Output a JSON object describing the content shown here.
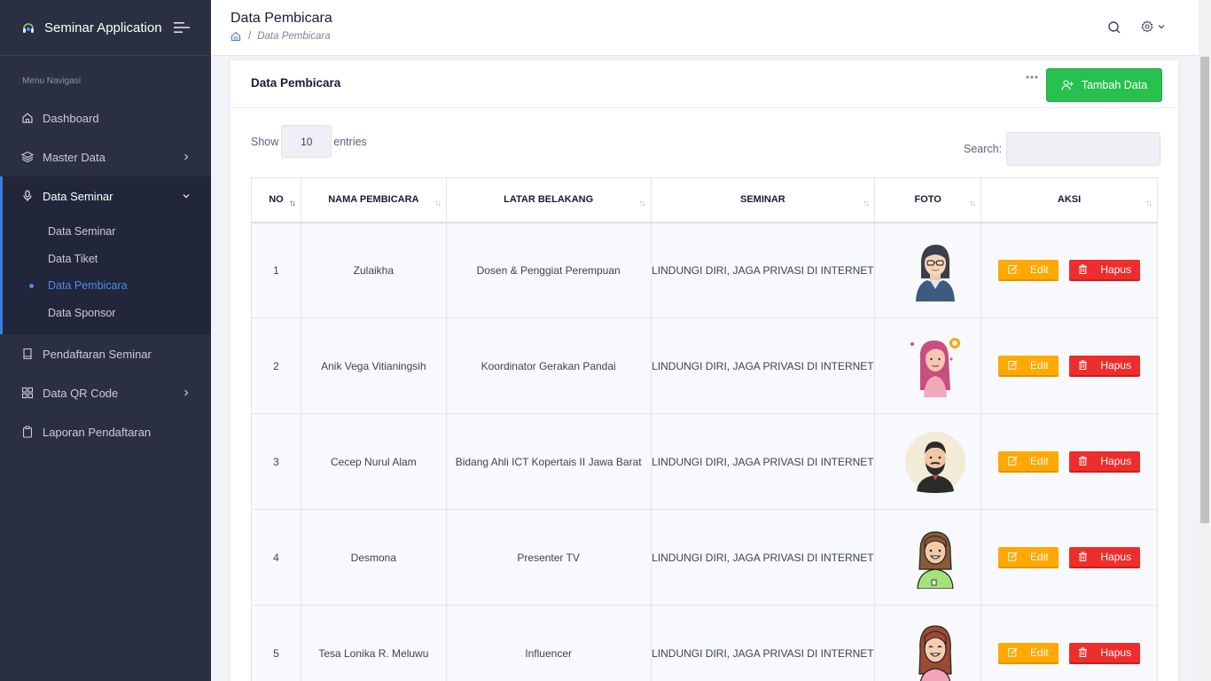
{
  "app": {
    "title": "Seminar Application"
  },
  "sidebar": {
    "heading": "Menu Navigasi",
    "items": [
      {
        "label": "Dashboard",
        "icon": "home-icon"
      },
      {
        "label": "Master Data",
        "icon": "layers-icon"
      },
      {
        "label": "Data Seminar",
        "icon": "mic-icon"
      },
      {
        "label": "Pendaftaran Seminar",
        "icon": "book-icon"
      },
      {
        "label": "Data QR Code",
        "icon": "grid-icon"
      },
      {
        "label": "Laporan Pendaftaran",
        "icon": "clipboard-icon"
      }
    ],
    "sub_items": [
      {
        "label": "Data Seminar"
      },
      {
        "label": "Data Tiket"
      },
      {
        "label": "Data Pembicara"
      },
      {
        "label": "Data Sponsor"
      }
    ]
  },
  "header": {
    "title": "Data Pembicara",
    "breadcrumb_sep": "/",
    "breadcrumb_current": "Data Pembicara"
  },
  "card": {
    "title": "Data Pembicara",
    "add_button": "Tambah Data",
    "show_label": "Show",
    "entries_value": "10",
    "entries_label": "entries",
    "search_label": "Search:"
  },
  "table": {
    "columns": [
      "NO",
      "NAMA PEMBICARA",
      "LATAR BELAKANG",
      "SEMINAR",
      "FOTO",
      "AKSI"
    ],
    "rows": [
      {
        "no": "1",
        "nama": "Zulaikha",
        "latar": "Dosen & Penggiat Perempuan",
        "seminar": "LINDUNGI DIRI, JAGA PRIVASI DI INTERNET"
      },
      {
        "no": "2",
        "nama": "Anik Vega Vitianingsih",
        "latar": "Koordinator Gerakan Pandai",
        "seminar": "LINDUNGI DIRI, JAGA PRIVASI DI INTERNET"
      },
      {
        "no": "3",
        "nama": "Cecep Nurul Alam",
        "latar": "Bidang Ahli ICT Kopertais II Jawa Barat",
        "seminar": "LINDUNGI DIRI, JAGA PRIVASI DI INTERNET"
      },
      {
        "no": "4",
        "nama": "Desmona",
        "latar": "Presenter TV",
        "seminar": "LINDUNGI DIRI, JAGA PRIVASI DI INTERNET"
      },
      {
        "no": "5",
        "nama": "Tesa Lonika R. Meluwu",
        "latar": "Influencer",
        "seminar": "LINDUNGI DIRI, JAGA PRIVASI DI INTERNET"
      }
    ],
    "edit_label": "Edit",
    "delete_label": "Hapus"
  },
  "colors": {
    "sidebar_bg": "#2a2f41",
    "accent_blue": "#4a8cf0",
    "add_green": "#28c04f",
    "edit_orange": "#ffa800",
    "delete_red": "#ee2d2d"
  }
}
